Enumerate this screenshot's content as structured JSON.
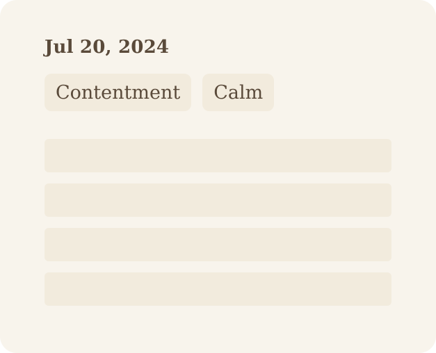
{
  "entry": {
    "date": "Jul 20, 2024",
    "tags": [
      "Contentment",
      "Calm"
    ]
  },
  "colors": {
    "card_background": "#f8f4ec",
    "chip_background": "#f2ebdd",
    "text": "#5a4a3a"
  }
}
